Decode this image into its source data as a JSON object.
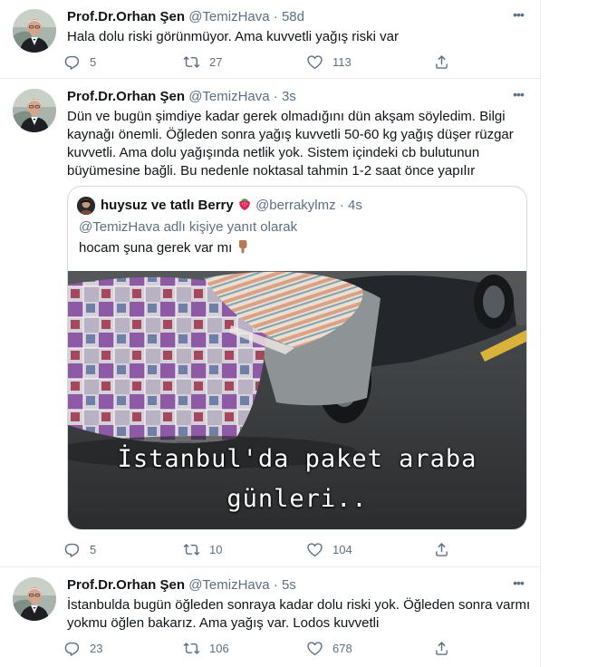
{
  "tweets": [
    {
      "name": "Prof.Dr.Orhan Şen",
      "handle": "@TemizHava",
      "dot": "·",
      "time": "58d",
      "text": "Hala dolu riski görünmüyor. Ama kuvvetli yağış riski var",
      "replies": "5",
      "retweets": "27",
      "likes": "113"
    },
    {
      "name": "Prof.Dr.Orhan Şen",
      "handle": "@TemizHava",
      "dot": "·",
      "time": "3s",
      "text_lines": [
        "Dün ve bugün şimdiye kadar gerek olmadığını dün akşam söyledim. Bilgi",
        "kaynağı önemli. Öğleden sonra yağış kuvvetli 50-60 kg yağış düşer rüzgar",
        "kuvvetli. Ama dolu yağışında netlik yok. Sistem içindeki cb bulutunun",
        "büyümesine bağli. Bu nedenle noktasal tahmin 1-2 saat önce yapılır"
      ],
      "quote": {
        "name": "huysuz ve tatlı Berry",
        "handle": "@berrakylmz",
        "dot": "·",
        "time": "4s",
        "reply_to": "@TemizHava adlı kişiye yanıt olarak",
        "text": "hocam şuna gerek var mı",
        "caption_line1": "İstanbul'da paket araba",
        "caption_line2": "günleri.."
      },
      "replies": "5",
      "retweets": "10",
      "likes": "104"
    },
    {
      "name": "Prof.Dr.Orhan Şen",
      "handle": "@TemizHava",
      "dot": "·",
      "time": "5s",
      "text_lines": [
        "İstanbulda bugün öğleden sonraya kadar dolu riski yok. Öğleden sonra varmı",
        "yokmu öğlen bakarız. Ama yağış var. Lodos kuvvetli"
      ],
      "replies": "23",
      "retweets": "106",
      "likes": "678"
    }
  ],
  "colors": {
    "text": "#0f1419",
    "secondary": "#5b7083",
    "border": "#e6ecf0"
  },
  "icons": {
    "reply": "reply-icon",
    "retweet": "retweet-icon",
    "like": "heart-icon",
    "share": "share-icon",
    "more": "more-icon"
  }
}
